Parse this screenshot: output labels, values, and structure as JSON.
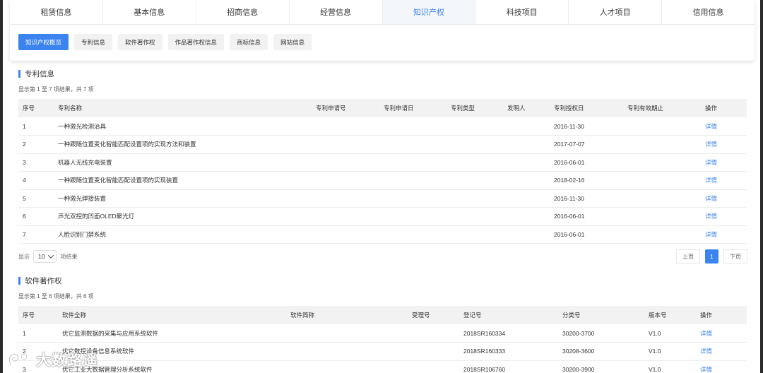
{
  "main_tabs": [
    "租赁信息",
    "基本信息",
    "招商信息",
    "经营信息",
    "知识产权",
    "科技项目",
    "人才项目",
    "信用信息"
  ],
  "active_main_tab": "知识产权",
  "sub_tabs": [
    "知识产权概览",
    "专利信息",
    "软件著作权",
    "作品著作权信息",
    "商标信息",
    "网站信息"
  ],
  "active_sub_tab": "知识产权概览",
  "patent": {
    "title": "专利信息",
    "summary": "显示第 1 至 7 项结果，共 7 项",
    "columns": [
      "序号",
      "专利名称",
      "专利申请号",
      "专利申请日",
      "专利类型",
      "发明人",
      "专利授权日",
      "专利有效期止",
      "操作"
    ],
    "rows": [
      {
        "no": "1",
        "name": "一种激光检测治具",
        "app_no": "",
        "app_date": "",
        "type": "",
        "inventor": "",
        "grant_date": "2016-11-30",
        "expiry": "",
        "action": "详情"
      },
      {
        "no": "2",
        "name": "一种跟随位置变化智能匹配设置项的实现方法和装置",
        "app_no": "",
        "app_date": "",
        "type": "",
        "inventor": "",
        "grant_date": "2017-07-07",
        "expiry": "",
        "action": "详情"
      },
      {
        "no": "3",
        "name": "机器人无线充电装置",
        "app_no": "",
        "app_date": "",
        "type": "",
        "inventor": "",
        "grant_date": "2016-06-01",
        "expiry": "",
        "action": "详情"
      },
      {
        "no": "4",
        "name": "一种跟随位置变化智能匹配设置项的实现装置",
        "app_no": "",
        "app_date": "",
        "type": "",
        "inventor": "",
        "grant_date": "2018-02-16",
        "expiry": "",
        "action": "详情"
      },
      {
        "no": "5",
        "name": "一种激光焊接装置",
        "app_no": "",
        "app_date": "",
        "type": "",
        "inventor": "",
        "grant_date": "2016-11-30",
        "expiry": "",
        "action": "详情"
      },
      {
        "no": "6",
        "name": "声光双控的凹面OLED聚光灯",
        "app_no": "",
        "app_date": "",
        "type": "",
        "inventor": "",
        "grant_date": "2016-06-01",
        "expiry": "",
        "action": "详情"
      },
      {
        "no": "7",
        "name": "人脸识别门禁系统",
        "app_no": "",
        "app_date": "",
        "type": "",
        "inventor": "",
        "grant_date": "2016-06-01",
        "expiry": "",
        "action": "详情"
      }
    ],
    "page_size_prefix": "显示",
    "page_size": "10",
    "page_size_suffix": "项结果",
    "prev": "上页",
    "current_page": "1",
    "next": "下页"
  },
  "software": {
    "title": "软件著作权",
    "summary": "显示第 1 至 6 项结果，共 6 项",
    "columns": [
      "序号",
      "软件全称",
      "软件简称",
      "受理号",
      "登记号",
      "分类号",
      "版本号",
      "操作"
    ],
    "rows": [
      {
        "no": "1",
        "full": "优它监测数据的采集与应用系统软件",
        "short": "",
        "accept": "",
        "reg": "2018SR160334",
        "cls": "30200-3700",
        "ver": "V1.0",
        "action": "详情"
      },
      {
        "no": "2",
        "full": "优它数控设备信息系统软件",
        "short": "",
        "accept": "",
        "reg": "2018SR160333",
        "cls": "30208-3600",
        "ver": "V1.0",
        "action": "详情"
      },
      {
        "no": "3",
        "full": "优它工业大数据管理分析系统软件",
        "short": "",
        "accept": "",
        "reg": "2018SR106760",
        "cls": "30200-3900",
        "ver": "V1.0",
        "action": "详情"
      }
    ]
  },
  "watermark": {
    "text": "大数路遥",
    "icon": "swirl-logo-icon"
  },
  "colors": {
    "accent": "#3b84f0",
    "header_bg": "#f2f2f2"
  }
}
